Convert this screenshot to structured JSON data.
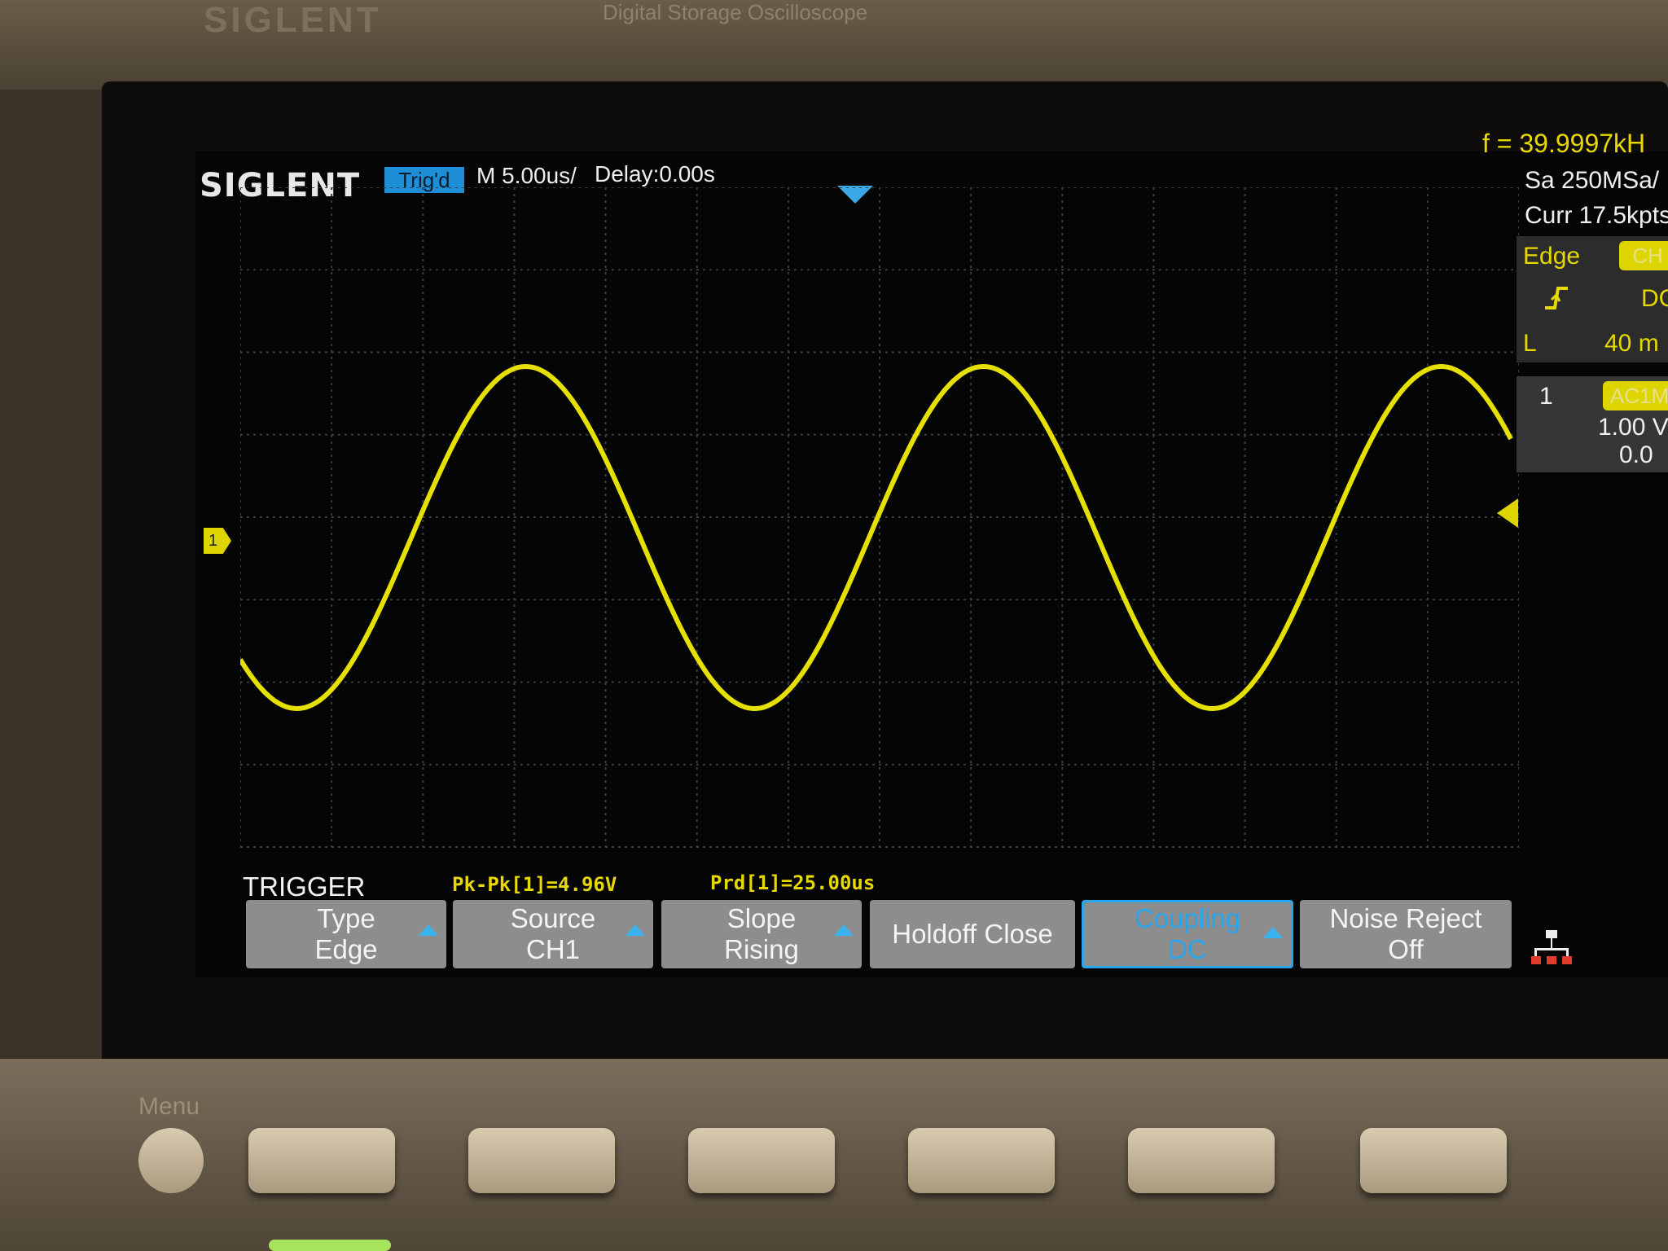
{
  "bezel": {
    "brand_text": "SIGLENT",
    "model_text": "Digital Storage Oscilloscope"
  },
  "header": {
    "logo": "SIGLENT",
    "trig_status": "Trig'd",
    "timebase": "M 5.00us/",
    "delay": "Delay:0.00s"
  },
  "side_panel": {
    "frequency": "f = 39.9997kH",
    "sample_rate": "Sa 250MSa/",
    "curr_points": "Curr 17.5kpts",
    "trigger_type": "Edge",
    "trigger_source_badge": "CH",
    "slope_icon": "rising-edge-icon",
    "trigger_coupling": "DC",
    "level_label": "L",
    "level_value": "40 m",
    "channel_number": "1",
    "channel_coupling_badge": "AC1M",
    "volts_per_div": "1.00 V",
    "offset": "0.0"
  },
  "measurements": {
    "pkpk": "Pk-Pk[1]=4.96V",
    "period": "Prd[1]=25.00us"
  },
  "menu": {
    "title": "TRIGGER",
    "softkeys": [
      {
        "line1": "Type",
        "line2": "Edge"
      },
      {
        "line1": "Source",
        "line2": "CH1"
      },
      {
        "line1": "Slope",
        "line2": "Rising"
      },
      {
        "line1": "Holdoff Close",
        "line2": ""
      },
      {
        "line1": "Coupling",
        "line2": "DC"
      },
      {
        "line1": "Noise Reject",
        "line2": "Off"
      }
    ]
  },
  "hardware": {
    "menu_label": "Menu"
  },
  "trace": {
    "color": "#e6e000",
    "frequency_khz": 40,
    "amplitude_vpp": 4.96
  }
}
